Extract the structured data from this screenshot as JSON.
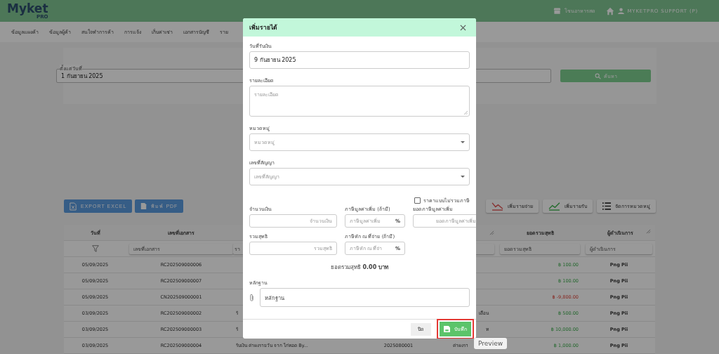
{
  "header": {
    "logo": "Myket",
    "logo_badge": "PRO",
    "store": "โซนอาหารสด",
    "user": "MYKETPRO SUPPORT (P)"
  },
  "nav": [
    "ข้อมูลแผงค้า",
    "ข้อมูลผู้ค้า",
    "สนใจทำการค้า",
    "การแจ้ง",
    "เก็บค่าเช่า",
    "เอกสารบัญชี",
    "ราย"
  ],
  "search": {
    "date_label": "ตั้งแต่วันที่",
    "date_value": "1 กันยายน 2025",
    "button": "ค้นหา"
  },
  "actions_left": [
    {
      "kind": "excel",
      "label": "EXPORT EXCEL"
    },
    {
      "kind": "pdf",
      "label": "พิมพ์ PDF"
    }
  ],
  "actions_right": [
    {
      "kind": "expense",
      "label": "เพิ่มรายจ่าย"
    },
    {
      "kind": "income",
      "label": "เพิ่มรายรับ"
    },
    {
      "kind": "categories",
      "label": "จัดการหมวดหมู่"
    }
  ],
  "table": {
    "columns": {
      "date": "วันที่",
      "document_no": "เลขที่เอกสาร",
      "net_total": "ยอดรวมสุทธิ",
      "operator": "ผู้ดำเนินการ"
    },
    "filters": {
      "document_no": "เลขที่เอกสาร",
      "column_3": "รา",
      "net_total": "ยอดรวมสุทธิ",
      "operator": "ผู้ดำเนินการ"
    },
    "rows": [
      {
        "date": "05/09/2025",
        "document_no": "RC202509000006",
        "net_total": "฿ 100.00",
        "kind": "income",
        "operator": "Png Pii"
      },
      {
        "date": "05/09/2025",
        "document_no": "RC202509000007",
        "net_total": "฿ 100.00",
        "kind": "income",
        "operator": "Png Pii"
      },
      {
        "date": "05/09/2025",
        "document_no": "CN202509000001",
        "net_total": "฿ -9,800.00",
        "kind": "expense",
        "operator": "Png Pii"
      },
      {
        "date": "03/09/2025",
        "document_no": "RC202509000002",
        "column_3": "รั",
        "column_5_tail": "เดือน",
        "net_total": "฿ 500.00",
        "kind": "income",
        "operator": "Png Pii"
      },
      {
        "date": "03/09/2025",
        "document_no": "RC202509000003",
        "column_3": "รั",
        "column_5_tail": "ท",
        "net_total": "฿ 10,000.00",
        "kind": "income",
        "operator": "Png Pii"
      },
      {
        "date": "03/09/2025",
        "document_no": "RC202509000004",
        "column_3": "รับเงิน ค่าผงรายวัน จาก ไก่ทอด By...",
        "column_4": "2025080001",
        "column_5": "ค่าผงรา",
        "net_total": "฿ 1,000.00",
        "kind": "income",
        "operator": "Png Pii"
      }
    ]
  },
  "dialog": {
    "title": "เพิ่มรายได้",
    "fields": [
      {
        "kind": "input",
        "label": "วันที่รับเงิน",
        "value": "9 กันยายน 2025"
      },
      {
        "kind": "textarea",
        "label": "รายละเอียด",
        "placeholder": "รายละเอียด"
      },
      {
        "kind": "select",
        "label": "หมวดหมู่",
        "placeholder": "หมวดหมู่"
      },
      {
        "kind": "select",
        "label": "เลขที่สัญญา",
        "placeholder": "เลขที่สัญญา"
      }
    ],
    "tax_exclusive": {
      "label": "ราคาแบบไม่รวมภาษี",
      "checked": false
    },
    "amount_fields": [
      {
        "label": "จำนวนเงิน",
        "placeholder": "จำนวนเงิน"
      },
      {
        "label": "ภาษีมูลค่าเพิ่ม (ถ้ามี)",
        "placeholder": "ภาษีมูลค่าเพิ่ม",
        "suffix": "%"
      },
      {
        "label": "ยอดภาษีมูลค่าเพิ่ม",
        "placeholder": "ยอดภาษีมูลค่าเพิ่ม"
      },
      {
        "label": "รวมสุทธิ",
        "placeholder": "รวมสุทธิ"
      },
      {
        "label": "ภาษีหัก ณ ที่จ่าย (ถ้ามี)",
        "placeholder": "ภาษีหัก ณ ที่จ่า",
        "suffix": "%"
      }
    ],
    "total": "ยอดรวมสุทธิ **0.00 บาท**",
    "evidence": {
      "label": "หลักฐาน",
      "placeholder": "หลักฐาน"
    },
    "buttons": [
      {
        "kind": "close",
        "label": "ปิด",
        "highlighted": false
      },
      {
        "kind": "save",
        "label": "บันทึก",
        "highlighted": true
      }
    ]
  },
  "tooltip": "Preview"
}
